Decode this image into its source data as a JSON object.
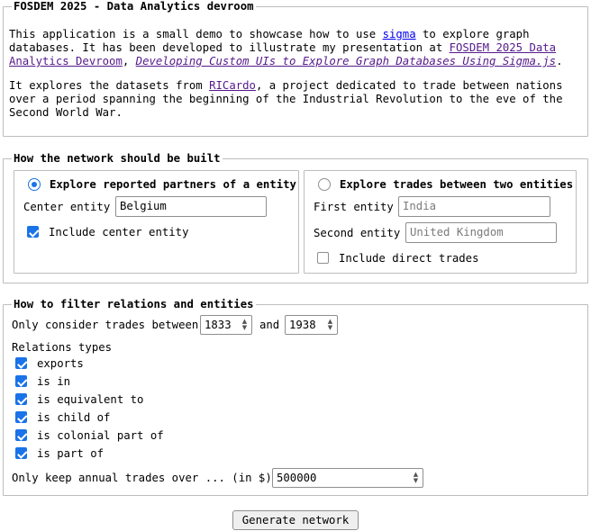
{
  "intro": {
    "legend": "FOSDEM 2025 - Data Analytics devroom",
    "p1_before_sigma": "This application is a small demo to showcase how to use ",
    "sigma_link": "sigma",
    "p1_mid": " to explore graph databases. It has been developed to illustrate my presentation at ",
    "fosdem_link": "FOSDEM 2025 Data Analytics Devroom",
    "p1_comma": ", ",
    "talk_link": "Developing Custom UIs to Explore Graph Databases Using Sigma.js",
    "p1_end": ".",
    "p2_before_ricardo": "It explores the datasets from ",
    "ricardo_link": "RICardo",
    "p2_after": ", a project dedicated to trade between nations over a period spanning the beginning of the Industrial Revolution to the eve of the Second World War."
  },
  "build": {
    "legend": "How the network should be built",
    "partners": {
      "radio_label": "Explore reported partners of a entity",
      "selected": true,
      "center_label": "Center entity",
      "center_value": "Belgium",
      "include_center_label": "Include center entity",
      "include_center_checked": true
    },
    "trades": {
      "radio_label": "Explore trades between two entities",
      "selected": false,
      "first_label": "First entity",
      "first_placeholder": "India",
      "second_label": "Second entity",
      "second_placeholder": "United Kingdom",
      "include_direct_label": "Include direct trades",
      "include_direct_checked": false
    }
  },
  "filter": {
    "legend": "How to filter relations and entities",
    "years_label": "Only consider trades between",
    "year_from": "1833",
    "and_label": "and",
    "year_to": "1938",
    "relations_label": "Relations types",
    "relations": [
      {
        "label": "exports",
        "checked": true
      },
      {
        "label": "is in",
        "checked": true
      },
      {
        "label": "is equivalent to",
        "checked": true
      },
      {
        "label": "is child of",
        "checked": true
      },
      {
        "label": "is colonial part of",
        "checked": true
      },
      {
        "label": "is part of",
        "checked": true
      }
    ],
    "min_trade_label": "Only keep annual trades over ... (in $)",
    "min_trade_value": "500000"
  },
  "submit_label": "Generate network",
  "colors": {
    "accent": "#1a73e8",
    "link": "#0000ee",
    "visited_link": "#551a8b",
    "border": "#bdbdbd"
  }
}
